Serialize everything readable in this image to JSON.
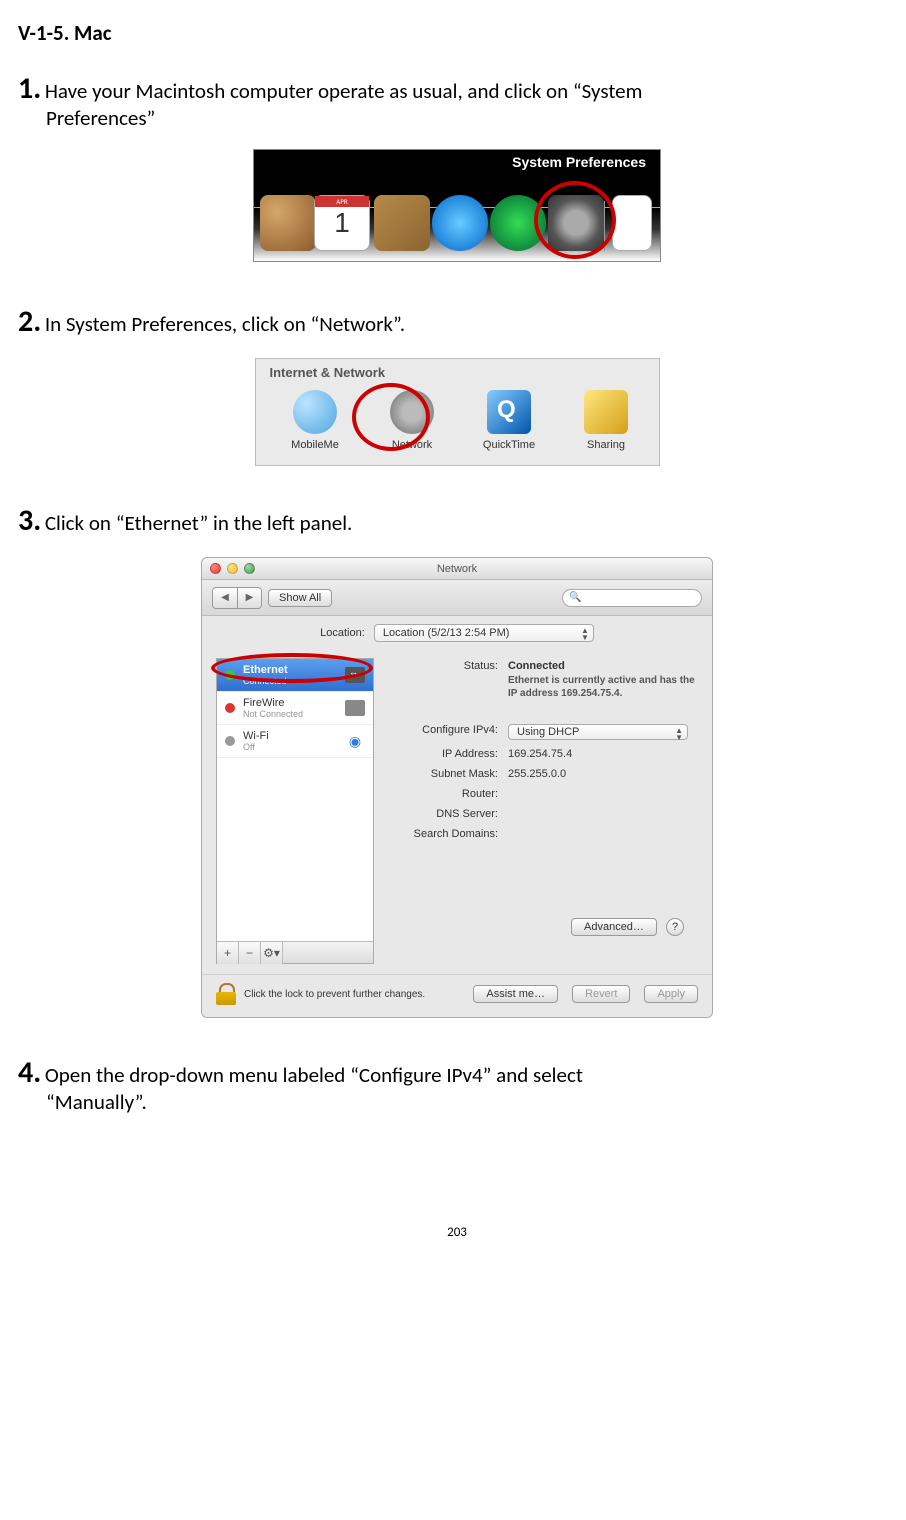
{
  "heading": "V-1-5.    Mac",
  "steps": {
    "s1": {
      "num": "1.",
      "text": "Have your Macintosh computer operate as usual, and click on “System",
      "cont": "Preferences”"
    },
    "s2": {
      "num": "2.",
      "text": "In System Preferences, click on “Network”."
    },
    "s3": {
      "num": "3.",
      "text": "Click on “Ethernet” in the left panel."
    },
    "s4": {
      "num": "4.",
      "text": "Open the drop-down menu labeled “Configure IPv4” and select",
      "cont": "“Manually”."
    }
  },
  "dock": {
    "tooltip": "System Preferences"
  },
  "inet": {
    "title": "Internet & Network",
    "items": [
      "MobileMe",
      "Network",
      "QuickTime",
      "Sharing"
    ]
  },
  "net": {
    "title": "Network",
    "showAll": "Show All",
    "location_label": "Location:",
    "location_value": "Location (5/2/13 2:54 PM)",
    "sidebar": [
      {
        "name": "Ethernet",
        "sub": "Connected",
        "dot": "green"
      },
      {
        "name": "FireWire",
        "sub": "Not Connected",
        "dot": "red"
      },
      {
        "name": "Wi-Fi",
        "sub": "Off",
        "dot": "grey"
      }
    ],
    "status_label": "Status:",
    "status_value": "Connected",
    "status_sub": "Ethernet is currently active and has the IP address 169.254.75.4.",
    "configure_label": "Configure IPv4:",
    "configure_value": "Using DHCP",
    "ip_label": "IP Address:",
    "ip_value": "169.254.75.4",
    "mask_label": "Subnet Mask:",
    "mask_value": "255.255.0.0",
    "router_label": "Router:",
    "dns_label": "DNS Server:",
    "search_label": "Search Domains:",
    "advanced": "Advanced…",
    "lock_text": "Click the lock to prevent further changes.",
    "assist": "Assist me…",
    "revert": "Revert",
    "apply": "Apply",
    "help": "?"
  },
  "page_number": "203"
}
